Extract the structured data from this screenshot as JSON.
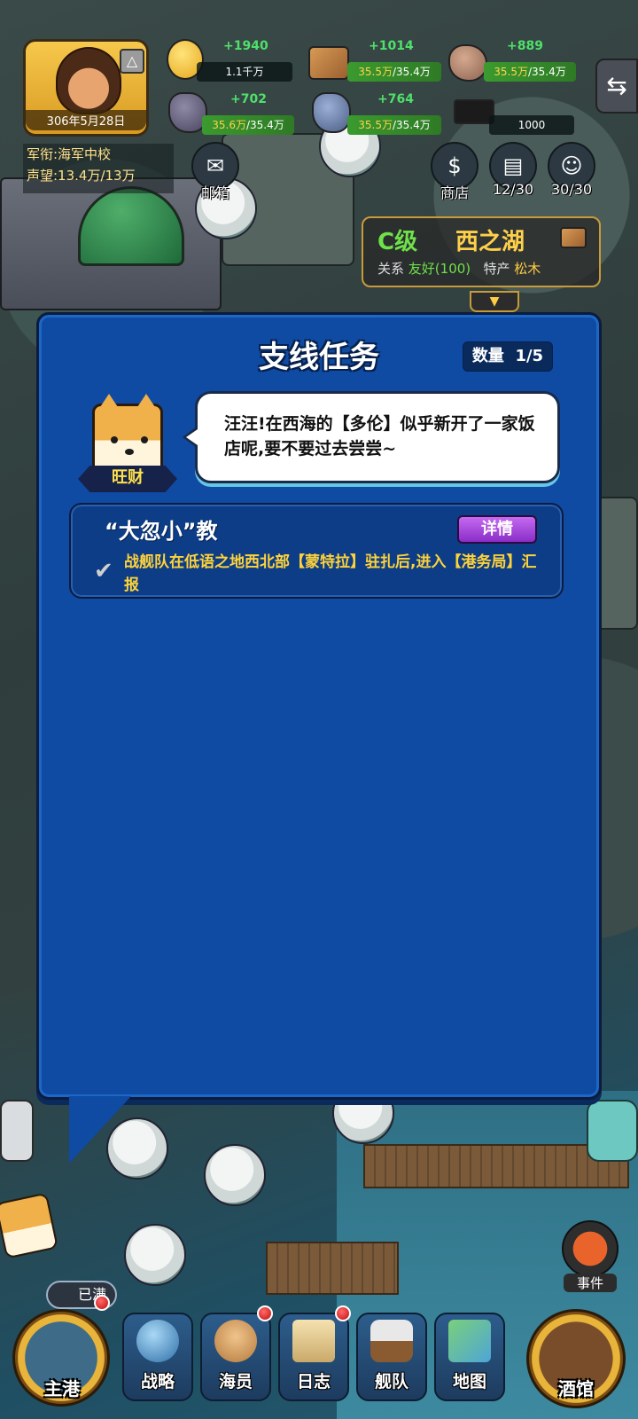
{
  "player": {
    "date": "306年5月28日",
    "rank_line": "军衔:海军中校",
    "reputation_line": "声望:13.4万/13万"
  },
  "resources": {
    "coin": {
      "gain": "+1940",
      "amount": "1.1千万"
    },
    "wood": {
      "gain": "+1014",
      "current": "35.5万",
      "cap": "/35.4万"
    },
    "stone": {
      "gain": "+889",
      "current": "35.5万",
      "cap": "/35.4万"
    },
    "ore": {
      "gain": "+702",
      "current": "35.6万",
      "cap": "/35.4万"
    },
    "crystal": {
      "gain": "+764",
      "current": "35.5万",
      "cap": "/35.4万"
    },
    "cap_item": {
      "amount": "1000"
    }
  },
  "top_buttons": {
    "mail": "邮箱",
    "shop": "商店",
    "book": "12/30",
    "fleet": "30/30"
  },
  "region": {
    "grade": "C级",
    "name": "西之湖",
    "relation_label": "关系",
    "relation_value": "友好(100)",
    "specialty_label": "特产",
    "specialty_value": "松木"
  },
  "modal": {
    "title": "支线任务",
    "count_label": "数量",
    "count_value": "1/5",
    "npc_name": "旺财",
    "dialog": "汪汪!在西海的【多伦】似乎新开了一家饭店呢,要不要过去尝尝~",
    "task": {
      "title": "“大忽小”教",
      "detail_button": "详情",
      "description": "战舰队在低语之地西北部【蒙特拉】驻扎后,进入【港务局】汇报"
    }
  },
  "bottom_nav": {
    "main_port": "主港",
    "full_badge": "已满",
    "items": [
      {
        "label": "战略",
        "icon": "globe-icon"
      },
      {
        "label": "海员",
        "icon": "sailor-icon"
      },
      {
        "label": "日志",
        "icon": "scroll-icon"
      },
      {
        "label": "舰队",
        "icon": "ship-icon"
      },
      {
        "label": "地图",
        "icon": "map-icon"
      }
    ],
    "tavern": "酒馆",
    "event": "事件"
  }
}
